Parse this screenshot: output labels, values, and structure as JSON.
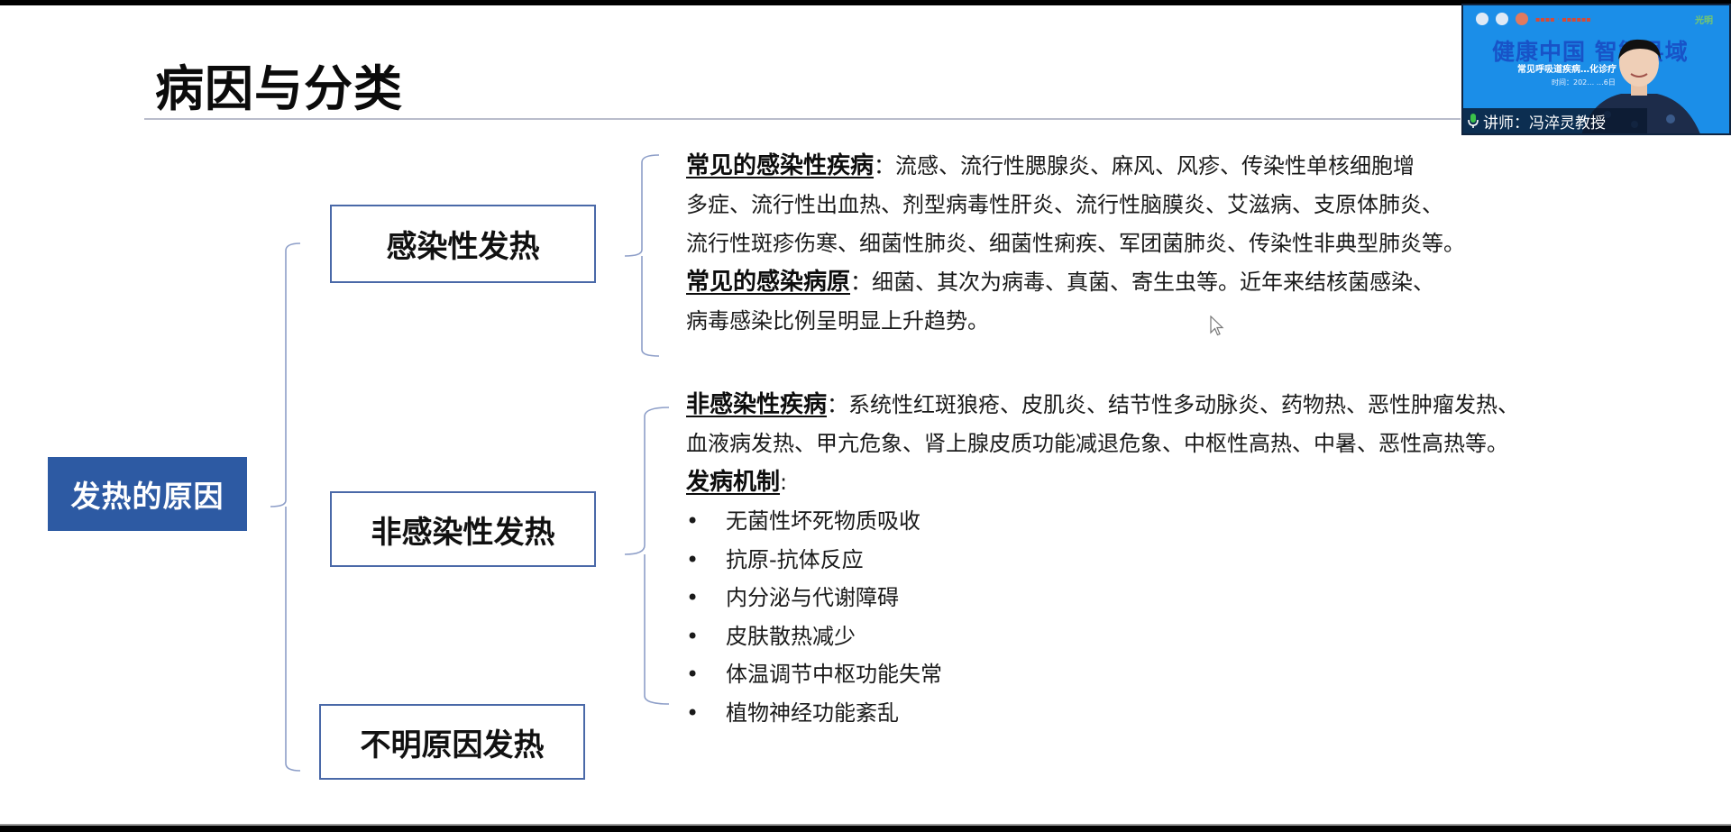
{
  "slide": {
    "title": "病因与分类",
    "root_label": "发热的原因",
    "categories": [
      {
        "label": "感染性发热"
      },
      {
        "label": "非感染性发热"
      },
      {
        "label": "不明原因发热"
      }
    ],
    "infectious": {
      "diseases_heading": "常见的感染性疾病",
      "diseases_lines": [
        "：流感、流行性腮腺炎、麻风、风疹、传染性单核细胞增",
        "多症、流行性出血热、剂型病毒性肝炎、流行性脑膜炎、艾滋病、支原体肺炎、",
        "流行性斑疹伤寒、细菌性肺炎、细菌性痢疾、军团菌肺炎、传染性非典型肺炎等。"
      ],
      "pathogens_heading": "常见的感染病原",
      "pathogens_lines": [
        "：细菌、其次为病毒、真菌、寄生虫等。近年来结核菌感染、",
        "病毒感染比例呈明显上升趋势。"
      ]
    },
    "non_infectious": {
      "diseases_heading": "非感染性疾病",
      "diseases_lines": [
        "：系统性红斑狼疮、皮肌炎、结节性多动脉炎、药物热、恶性肿瘤发热、",
        "血液病发热、甲亢危象、肾上腺皮质功能减退危象、中枢性高热、中暑、恶性高热等。"
      ],
      "mechanism_heading": "发病机制",
      "mechanism_colon": ":",
      "bullet_glyph": "•",
      "mechanisms": [
        "无菌性坏死物质吸收",
        "抗原-抗体反应",
        "内分泌与代谢障碍",
        "皮肤散热减少",
        "体温调节中枢功能失常",
        "植物神经功能紊乱"
      ]
    }
  },
  "video_overlay": {
    "banner_title": "健康中国 智能县域",
    "banner_subtitle": "常见呼吸道疾病…化诊疗（一）",
    "banner_time": "时间：202… …6日",
    "logo_right": "光明",
    "speaker_caption": "讲师：冯淬灵教授",
    "icons": [
      "microphone-icon"
    ],
    "colors": {
      "banner_bg": "#1b8ee8",
      "banner_title": "#1853c7",
      "caption_bg": "#0a1830"
    }
  },
  "colors": {
    "root_box": "#2d5aa3",
    "box_border": "#4a69a8",
    "bracket": "#8d9ec8",
    "title_rule": "#b9bccb"
  }
}
